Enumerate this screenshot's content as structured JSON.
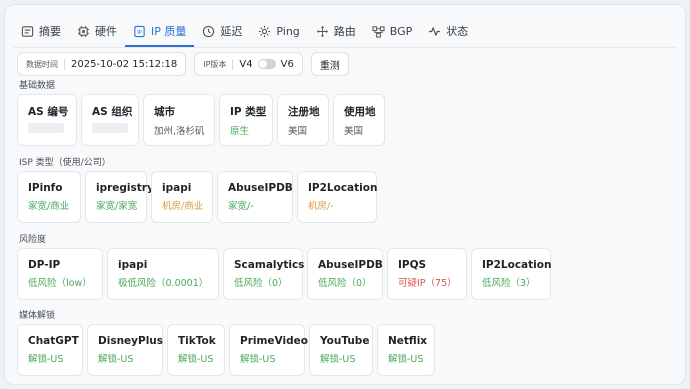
{
  "tabs": [
    {
      "label": "摘要",
      "icon": "summary-icon"
    },
    {
      "label": "硬件",
      "icon": "chip-icon"
    },
    {
      "label": "IP 质量",
      "icon": "ip-icon"
    },
    {
      "label": "延迟",
      "icon": "clock-icon"
    },
    {
      "label": "Ping",
      "icon": "ping-icon"
    },
    {
      "label": "路由",
      "icon": "route-icon"
    },
    {
      "label": "BGP",
      "icon": "bgp-icon"
    },
    {
      "label": "状态",
      "icon": "pulse-icon"
    }
  ],
  "active_tab": "IP 质量",
  "toolbar": {
    "time_label": "数据时间",
    "time_value": "2025-10-02 15:12:18",
    "ipver_label": "IP版本",
    "v4": "V4",
    "v6": "V6",
    "retest": "重测"
  },
  "sections": {
    "basic": "基础数据",
    "isp": "ISP 类型（使用/公司）",
    "risk": "风险度",
    "media": "媒体解锁"
  },
  "basic": [
    {
      "title": "AS 编号",
      "value": ""
    },
    {
      "title": "AS 组织",
      "value": ""
    },
    {
      "title": "城市",
      "value": "加州,洛杉矶"
    },
    {
      "title": "IP 类型",
      "value": "原生"
    },
    {
      "title": "注册地",
      "value": "美国"
    },
    {
      "title": "使用地",
      "value": "美国"
    }
  ],
  "isp": [
    {
      "title": "IPinfo",
      "value": "家宽/商业"
    },
    {
      "title": "ipregistry",
      "value": "家宽/家宽"
    },
    {
      "title": "ipapi",
      "value": "机房/商业"
    },
    {
      "title": "AbuseIPDB",
      "value": "家宽/-"
    },
    {
      "title": "IP2Location",
      "value": "机房/-"
    }
  ],
  "risk": [
    {
      "title": "DP-IP",
      "value": "低风险（low）"
    },
    {
      "title": "ipapi",
      "value": "极低风险（0.0001）"
    },
    {
      "title": "Scamalytics",
      "value": "低风险（0）"
    },
    {
      "title": "AbuseIPDB",
      "value": "低风险（0）"
    },
    {
      "title": "IPQS",
      "value": "可疑IP（75）"
    },
    {
      "title": "IP2Location",
      "value": "低风险（3）"
    }
  ],
  "media": [
    {
      "title": "ChatGPT",
      "value": "解锁-US"
    },
    {
      "title": "DisneyPlus",
      "value": "解锁-US"
    },
    {
      "title": "TikTok",
      "value": "解锁-US"
    },
    {
      "title": "PrimeVideo",
      "value": "解锁-US"
    },
    {
      "title": "YouTube",
      "value": "解锁-US"
    },
    {
      "title": "Netflix",
      "value": "解锁-US"
    }
  ],
  "colors": {
    "accent": "#2f6fd6",
    "good": "#4aa85c",
    "warn": "#d89b3a",
    "bad": "#d9534f"
  }
}
